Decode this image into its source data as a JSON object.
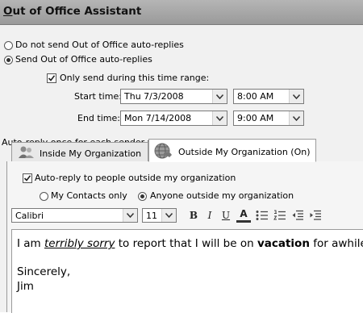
{
  "window": {
    "title": "Out of Office Assistant"
  },
  "mode": {
    "do_not_send_label": "Do not send Out of Office auto-replies",
    "send_label": "Send Out of Office auto-replies",
    "selected": "send"
  },
  "time_range": {
    "only_send_label": "Only send during this time range:",
    "only_send_checked": true,
    "start_label": "Start time:",
    "start_date": "Thu 7/3/2008",
    "start_time": "8:00 AM",
    "end_label": "End time:",
    "end_date": "Mon 7/14/2008",
    "end_time": "9:00 AM"
  },
  "auto_reply_caption": "Auto-reply once for each sender with the following messages:",
  "tabs": [
    {
      "label": "Inside My Organization",
      "icon": "people-icon",
      "active": false
    },
    {
      "label": "Outside My Organization (On)",
      "icon": "globe-icon",
      "active": true
    }
  ],
  "outside": {
    "auto_reply_label": "Auto-reply to people outside my organization",
    "auto_reply_checked": true,
    "my_contacts_label": "My Contacts only",
    "anyone_label": "Anyone outside my organization",
    "audience_selected": "anyone"
  },
  "format_toolbar": {
    "font": "Calibri",
    "size": "11",
    "bold": "B",
    "italic": "I",
    "underline": "U",
    "font_color": "A"
  },
  "message": {
    "part1": "I am ",
    "emph": "terribly sorry",
    "part2": " to report that I will be on ",
    "bold": "vacation",
    "part3": " for awhile",
    "closing": "Sincerely,",
    "signature": "Jim"
  }
}
